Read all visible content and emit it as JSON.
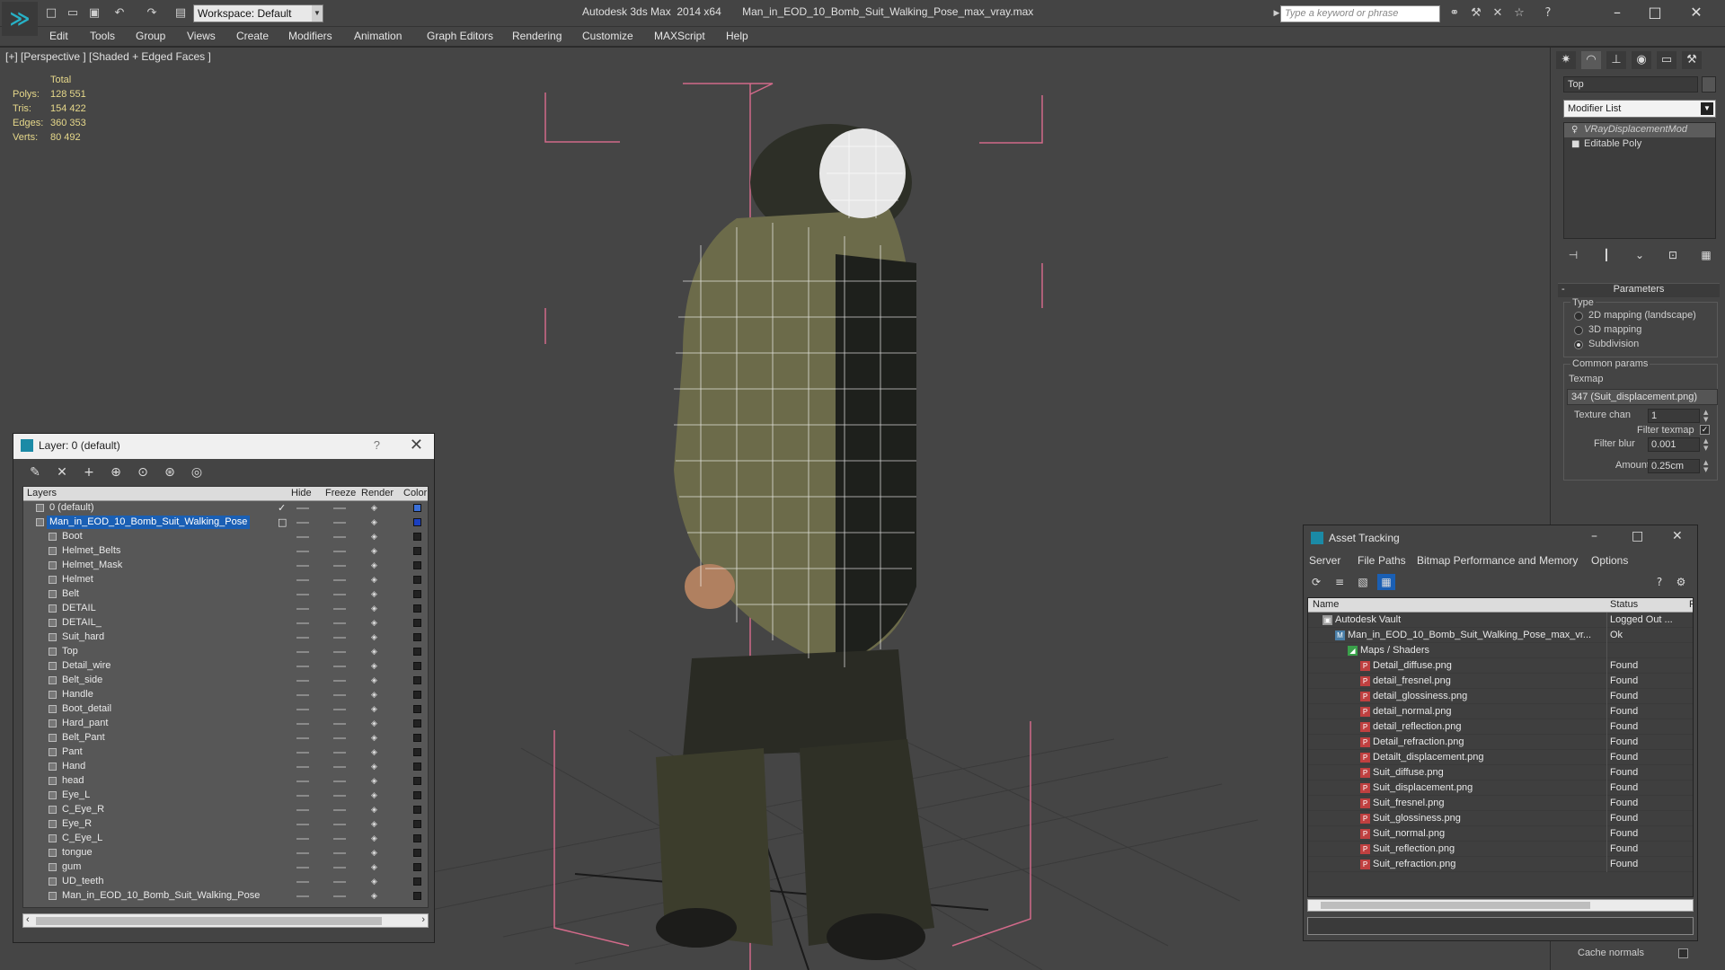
{
  "titlebar": {
    "workspace": "Workspace: Default",
    "title": "Autodesk 3ds Max  2014 x64       Man_in_EOD_10_Bomb_Suit_Walking_Pose_max_vray.max",
    "search_placeholder": "Type a keyword or phrase"
  },
  "menu": [
    "Edit",
    "Tools",
    "Group",
    "Views",
    "Create",
    "Modifiers",
    "Animation",
    "Graph Editors",
    "Rendering",
    "Customize",
    "MAXScript",
    "Help"
  ],
  "viewport": {
    "label": "[+] [Perspective ] [Shaded + Edged Faces ]",
    "stats": {
      "header": "Total",
      "rows": [
        {
          "k": "Polys:",
          "v": "128 551"
        },
        {
          "k": "Tris:",
          "v": "154 422"
        },
        {
          "k": "Edges:",
          "v": "360 353"
        },
        {
          "k": "Verts:",
          "v": "80 492"
        }
      ]
    }
  },
  "layer_window": {
    "title": "Layer: 0 (default)",
    "help": "?",
    "columns": {
      "layers": "Layers",
      "hide": "Hide",
      "freeze": "Freeze",
      "render": "Render",
      "color": "Color"
    },
    "layers": [
      {
        "name": "0 (default)",
        "level": 0,
        "check": true,
        "color": "#3a6fd8"
      },
      {
        "name": "Man_in_EOD_10_Bomb_Suit_Walking_Pose",
        "level": 0,
        "selected": true,
        "color": "#1a3fc0"
      },
      {
        "name": "Boot",
        "level": 1
      },
      {
        "name": "Helmet_Belts",
        "level": 1
      },
      {
        "name": "Helmet_Mask",
        "level": 1
      },
      {
        "name": "Helmet",
        "level": 1
      },
      {
        "name": "Belt",
        "level": 1
      },
      {
        "name": "DETAIL",
        "level": 1
      },
      {
        "name": "DETAIL_",
        "level": 1
      },
      {
        "name": "Suit_hard",
        "level": 1
      },
      {
        "name": "Top",
        "level": 1
      },
      {
        "name": "Detail_wire",
        "level": 1
      },
      {
        "name": "Belt_side",
        "level": 1
      },
      {
        "name": "Handle",
        "level": 1
      },
      {
        "name": "Boot_detail",
        "level": 1
      },
      {
        "name": "Hard_pant",
        "level": 1
      },
      {
        "name": "Belt_Pant",
        "level": 1
      },
      {
        "name": "Pant",
        "level": 1
      },
      {
        "name": "Hand",
        "level": 1
      },
      {
        "name": "head",
        "level": 1
      },
      {
        "name": "Eye_L",
        "level": 1
      },
      {
        "name": "C_Eye_R",
        "level": 1
      },
      {
        "name": "Eye_R",
        "level": 1
      },
      {
        "name": "C_Eye_L",
        "level": 1
      },
      {
        "name": "tongue",
        "level": 1
      },
      {
        "name": "gum",
        "level": 1
      },
      {
        "name": "UD_teeth",
        "level": 1
      },
      {
        "name": "Man_in_EOD_10_Bomb_Suit_Walking_Pose",
        "level": 1
      }
    ]
  },
  "command_panel": {
    "object_name": "Top",
    "modifier_list": "Modifier List",
    "stack": [
      {
        "name": "VRayDisplacementMod",
        "selected": true
      },
      {
        "name": "Editable Poly",
        "selected": false
      }
    ],
    "parameters_title": "Parameters",
    "type_label": "Type",
    "type_options": [
      {
        "label": "2D mapping (landscape)",
        "selected": false
      },
      {
        "label": "3D mapping",
        "selected": false
      },
      {
        "label": "Subdivision",
        "selected": true
      }
    ],
    "common_params": "Common params",
    "texmap_label": "Texmap",
    "texmap_value": "347 (Suit_displacement.png)",
    "texture_chan_label": "Texture chan",
    "texture_chan_value": "1",
    "filter_texmap_label": "Filter texmap",
    "filter_blur_label": "Filter blur",
    "filter_blur_value": "0.001",
    "amount_label": "Amount",
    "amount_value": "0.25cm",
    "cache_normals_label": "Cache normals"
  },
  "asset_window": {
    "title": "Asset Tracking",
    "menu": [
      "Server",
      "File",
      "Paths",
      "Bitmap Performance and Memory",
      "Options"
    ],
    "columns": {
      "name": "Name",
      "status": "Status",
      "p": "P"
    },
    "rows": [
      {
        "name": "Autodesk Vault",
        "status": "Logged Out ...",
        "indent": 0,
        "icon": "vault"
      },
      {
        "name": "Man_in_EOD_10_Bomb_Suit_Walking_Pose_max_vr...",
        "status": "Ok",
        "indent": 1,
        "icon": "max"
      },
      {
        "name": "Maps / Shaders",
        "status": "",
        "indent": 2,
        "icon": "maps"
      },
      {
        "name": "Detail_diffuse.png",
        "status": "Found",
        "indent": 3,
        "icon": "png"
      },
      {
        "name": "detail_fresnel.png",
        "status": "Found",
        "indent": 3,
        "icon": "png"
      },
      {
        "name": "detail_glossiness.png",
        "status": "Found",
        "indent": 3,
        "icon": "png"
      },
      {
        "name": "detail_normal.png",
        "status": "Found",
        "indent": 3,
        "icon": "png"
      },
      {
        "name": "detail_reflection.png",
        "status": "Found",
        "indent": 3,
        "icon": "png"
      },
      {
        "name": "Detail_refraction.png",
        "status": "Found",
        "indent": 3,
        "icon": "png"
      },
      {
        "name": "Detailt_displacement.png",
        "status": "Found",
        "indent": 3,
        "icon": "png"
      },
      {
        "name": "Suit_diffuse.png",
        "status": "Found",
        "indent": 3,
        "icon": "png"
      },
      {
        "name": "Suit_displacement.png",
        "status": "Found",
        "indent": 3,
        "icon": "png"
      },
      {
        "name": "Suit_fresnel.png",
        "status": "Found",
        "indent": 3,
        "icon": "png"
      },
      {
        "name": "Suit_glossiness.png",
        "status": "Found",
        "indent": 3,
        "icon": "png"
      },
      {
        "name": "Suit_normal.png",
        "status": "Found",
        "indent": 3,
        "icon": "png"
      },
      {
        "name": "Suit_reflection.png",
        "status": "Found",
        "indent": 3,
        "icon": "png"
      },
      {
        "name": "Suit_refraction.png",
        "status": "Found",
        "indent": 3,
        "icon": "png"
      }
    ]
  }
}
